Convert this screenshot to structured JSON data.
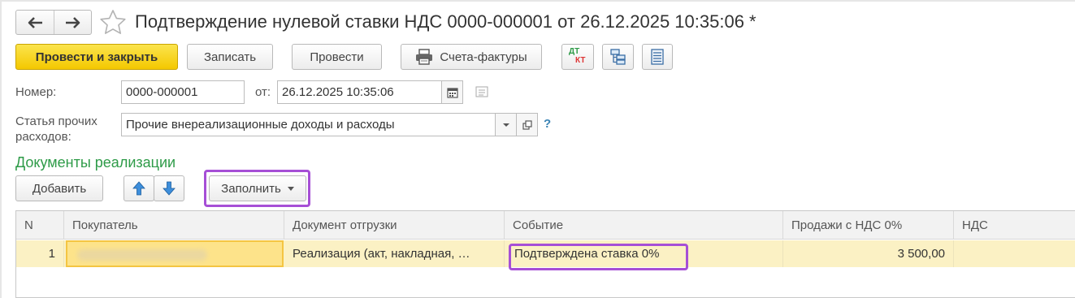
{
  "title": "Подтверждение нулевой ставки НДС 0000-000001 от 26.12.2025 10:35:06 *",
  "nav": {
    "back_icon": "arrow-left-icon",
    "forward_icon": "arrow-right-icon",
    "favorite_icon": "star-icon"
  },
  "toolbar": {
    "post_close": "Провести и закрыть",
    "save": "Записать",
    "post": "Провести",
    "invoices": "Счета-фактуры",
    "dt_kt_top": "ДТ",
    "dt_kt_bottom": "КТ"
  },
  "form": {
    "number_label": "Номер:",
    "number_value": "0000-000001",
    "date_label": "от:",
    "date_value": "26.12.2025 10:35:06",
    "expense_label_line1": "Статья прочих",
    "expense_label_line2": "расходов:",
    "expense_value": "Прочие внереализационные доходы и расходы",
    "help": "?"
  },
  "section_title": "Документы реализации",
  "table_toolbar": {
    "add": "Добавить",
    "fill": "Заполнить"
  },
  "table": {
    "columns": [
      "N",
      "Покупатель",
      "Документ отгрузки",
      "Событие",
      "Продажи с НДС 0%",
      "НДС"
    ],
    "rows": [
      {
        "n": "1",
        "buyer": "",
        "shipment_doc": "Реализация (акт, накладная, …",
        "event": "Подтверждена ставка 0%",
        "sales": "3 500,00",
        "vat": ""
      }
    ]
  },
  "colors": {
    "accent_yellow": "#f4c800",
    "section_green": "#2e9b48",
    "highlight_purple": "#a64fd6",
    "row_selected": "#fbf1c4"
  }
}
